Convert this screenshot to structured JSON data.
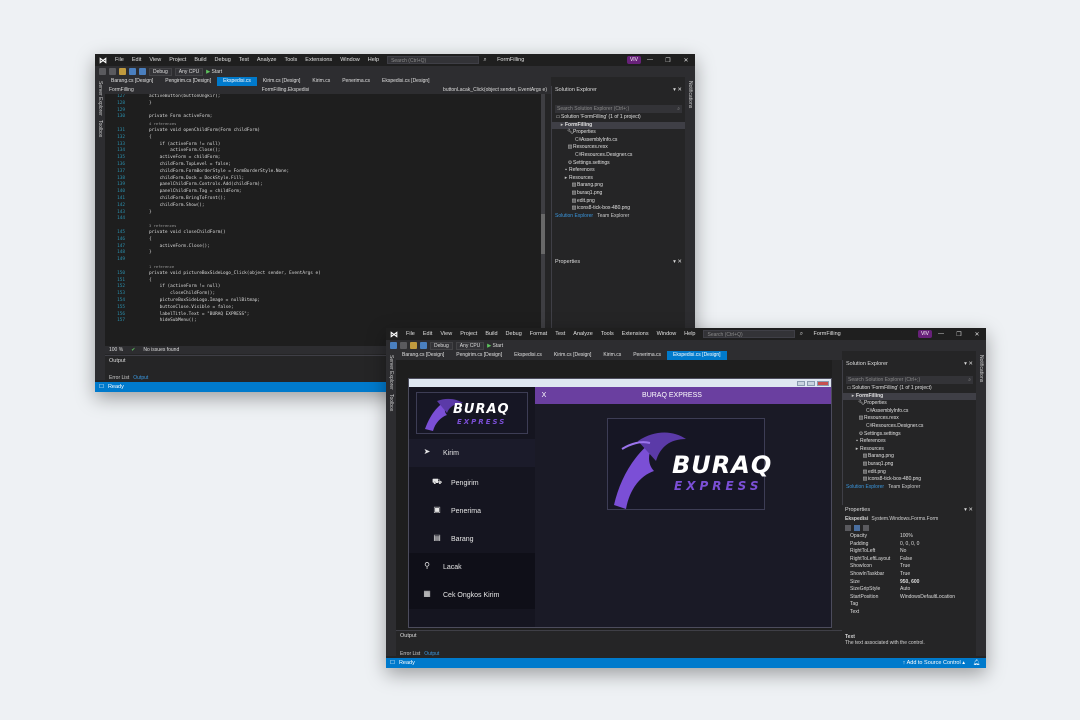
{
  "menu": [
    "File",
    "Edit",
    "View",
    "Project",
    "Build",
    "Debug",
    "Test",
    "Analyze",
    "Tools",
    "Extensions",
    "Window",
    "Help"
  ],
  "menu2": [
    "File",
    "Edit",
    "View",
    "Project",
    "Build",
    "Debug",
    "Format",
    "Test",
    "Analyze",
    "Tools",
    "Extensions",
    "Window",
    "Help"
  ],
  "search_placeholder": "Search (Ctrl+Q)",
  "solution_name": "FormFilling",
  "badge": "VIV",
  "toolbar": {
    "config": "Debug",
    "platform": "Any CPU",
    "start": "Start"
  },
  "sidebar_left": [
    "Server Explorer",
    "Toolbox"
  ],
  "sidebar_right": [
    "Notifications"
  ],
  "win1": {
    "tabs": [
      "Barang.cs [Design]",
      "Pengirim.cs [Design]",
      "Ekspedisi.cs",
      "Kirim.cs [Design]",
      "Kirim.cs",
      "Penerima.cs",
      "Ekspedisi.cs [Design]"
    ],
    "active_tab": "Ekspedisi.cs",
    "nav_project": "FormFilling",
    "nav_class": "FormFilling.Ekspedisi",
    "nav_member": "buttonLacak_Click(object sender, EventArgs e)",
    "code": [
      [
        "127",
        "activeButton(buttonOngkir);"
      ],
      [
        "128",
        "}"
      ],
      [
        "129",
        ""
      ],
      [
        "130",
        "private Form activeForm;"
      ],
      [
        "",
        "4 references"
      ],
      [
        "131",
        "private void openChildForm(Form childForm)"
      ],
      [
        "132",
        "{"
      ],
      [
        "133",
        "    if (activeForm != null)"
      ],
      [
        "134",
        "        activeForm.Close();"
      ],
      [
        "135",
        "    activeForm = childForm;"
      ],
      [
        "136",
        "    childForm.TopLevel = false;"
      ],
      [
        "137",
        "    childForm.FormBorderStyle = FormBorderStyle.None;"
      ],
      [
        "138",
        "    childForm.Dock = DockStyle.Fill;"
      ],
      [
        "139",
        "    panelChildForm.Controls.Add(childForm);"
      ],
      [
        "140",
        "    panelChildForm.Tag = childForm;"
      ],
      [
        "141",
        "    childForm.BringToFront();"
      ],
      [
        "142",
        "    childForm.Show();"
      ],
      [
        "143",
        "}"
      ],
      [
        "144",
        ""
      ],
      [
        "",
        "3 references"
      ],
      [
        "145",
        "private void closeChildForm()"
      ],
      [
        "146",
        "{"
      ],
      [
        "147",
        "    activeForm.Close();"
      ],
      [
        "148",
        "}"
      ],
      [
        "149",
        ""
      ],
      [
        "",
        "1 reference"
      ],
      [
        "150",
        "private void pictureBoxSideLogo_Click(object sender, EventArgs e)"
      ],
      [
        "151",
        "{"
      ],
      [
        "152",
        "    if (activeForm != null)"
      ],
      [
        "153",
        "        closeChildForm();"
      ],
      [
        "154",
        "    pictureBoxSideLogo.Image = nullBitmap;"
      ],
      [
        "155",
        "    buttonClose.Visible = false;"
      ],
      [
        "156",
        "    labelTitle.Text = \"BURAQ EXPRESS\";"
      ],
      [
        "157",
        "    hideSubMenu();"
      ]
    ],
    "zoom": "100 %",
    "issues": "No issues found",
    "output_title": "Output",
    "bottom_tabs": [
      "Error List",
      "Output"
    ],
    "status": "Ready"
  },
  "solution_explorer": {
    "title": "Solution Explorer",
    "search": "Search Solution Explorer (Ctrl+;)",
    "items": [
      "Solution 'FormFilling' (1 of 1 project)",
      "FormFilling",
      "Properties",
      "AssemblyInfo.cs",
      "Resources.resx",
      "Resources.Designer.cs",
      "Settings.settings",
      "References",
      "Resources",
      "Barang.png",
      "buraq1.png",
      "edit.png",
      "icons8-tick-box-480.png"
    ],
    "tabs": [
      "Solution Explorer",
      "Team Explorer"
    ]
  },
  "properties_panel": {
    "title": "Properties",
    "object": "Ekspedisi",
    "type": "System.Windows.Forms.Form",
    "rows": [
      [
        "Opacity",
        "100%"
      ],
      [
        "Padding",
        "0, 0, 0, 0"
      ],
      [
        "RightToLeft",
        "No"
      ],
      [
        "RightToLeftLayout",
        "False"
      ],
      [
        "ShowIcon",
        "True"
      ],
      [
        "ShowInTaskbar",
        "True"
      ],
      [
        "Size",
        "950, 600"
      ],
      [
        "SizeGripStyle",
        "Auto"
      ],
      [
        "StartPosition",
        "WindowsDefaultLocation"
      ],
      [
        "Tag",
        ""
      ],
      [
        "Text",
        ""
      ]
    ],
    "desc_title": "Text",
    "desc": "The text associated with the control."
  },
  "win2": {
    "tabs": [
      "Barang.cs [Design]",
      "Pengirim.cs [Design]",
      "Ekspedisi.cs",
      "Kirim.cs [Design]",
      "Kirim.cs",
      "Penerima.cs",
      "Ekspedisi.cs [Design]"
    ],
    "active_tab": "Ekspedisi.cs [Design]",
    "form_title": "BURAQ EXPRESS",
    "close_x": "X",
    "nav": [
      "Kirim",
      "Pengirim",
      "Penerima",
      "Barang",
      "Lacak",
      "Cek Ongkos Kirim"
    ],
    "logo_word1": "BURAQ",
    "logo_word2": "EXPRESS",
    "output_title": "Output",
    "bottom_tabs": [
      "Error List",
      "Output"
    ],
    "status": "Ready",
    "source_control": "Add to Source Control"
  },
  "colors": {
    "accent": "#007acc",
    "purple": "#6a3fa0",
    "brand_purple": "#7b4fd6"
  }
}
